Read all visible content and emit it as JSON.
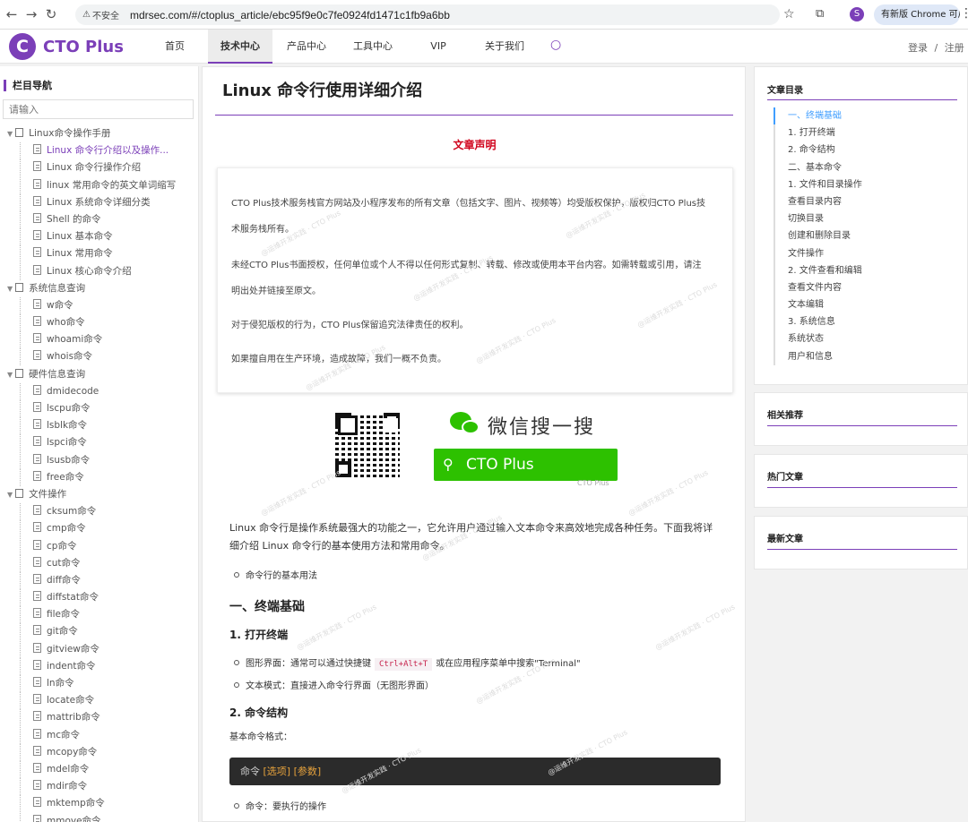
{
  "browser": {
    "url": "mdrsec.com/#/ctoplus_article/ebc95f9e0c7fe0924fd1471c1fb9a6bb",
    "security": "不安全",
    "profile_initial": "S",
    "update_label": "有新版 Chrome 可用"
  },
  "site": {
    "logo_letter": "C",
    "logo_text": "CTO Plus",
    "nav": [
      "首页",
      "技术中心",
      "产品中心",
      "工具中心",
      "VIP",
      "关于我们"
    ],
    "login": "登录",
    "separator": "/",
    "register": "注册"
  },
  "sidebar": {
    "title": "栏目导航",
    "search_placeholder": "请输入",
    "groups": [
      {
        "label": "Linux命令操作手册",
        "items": [
          "Linux 命令行介绍以及操作...",
          "Linux 命令行操作介绍",
          "linux 常用命令的英文单词缩写",
          "Linux 系统命令详细分类",
          "Shell 的命令",
          "Linux 基本命令",
          "Linux 常用命令",
          "Linux 核心命令介绍"
        ]
      },
      {
        "label": "系统信息查询",
        "items": [
          "w命令",
          "who命令",
          "whoami命令",
          "whois命令"
        ]
      },
      {
        "label": "硬件信息查询",
        "items": [
          "dmidecode",
          "lscpu命令",
          "lsblk命令",
          "lspci命令",
          "lsusb命令",
          "free命令"
        ]
      },
      {
        "label": "文件操作",
        "items": [
          "cksum命令",
          "cmp命令",
          "cp命令",
          "cut命令",
          "diff命令",
          "diffstat命令",
          "file命令",
          "git命令",
          "gitview命令",
          "indent命令",
          "ln命令",
          "locate命令",
          "mattrib命令",
          "mc命令",
          "mcopy命令",
          "mdel命令",
          "mdir命令",
          "mktemp命令",
          "mmove命令"
        ]
      }
    ]
  },
  "article": {
    "title": "Linux 命令行使用详细介绍",
    "declaration_title": "文章声明",
    "declaration": [
      "CTO Plus技术服务栈官方网站及小程序发布的所有文章（包括文字、图片、视频等）均受版权保护，版权归CTO Plus技",
      "术服务栈所有。",
      "未经CTO Plus书面授权，任何单位或个人不得以任何形式复制、转载、修改或使用本平台内容。如需转载或引用，请注",
      "明出处并链接至原文。",
      "对于侵犯版权的行为，CTO Plus保留追究法律责任的权利。",
      "如果擅自用在生产环境，造成故障，我们一概不负责。"
    ],
    "wechat_label": "微信搜一搜",
    "wechat_search": "CTO Plus",
    "wechat_small": "CTO Plus",
    "intro_1": "Linux 命令行是操作系统最强大的功能之一，它允许用户通过输入文本命令来高效地完成各种任务。下面我将详",
    "intro_2": "细介绍 Linux 命令行的基本使用方法和常用命令。",
    "bullet_basic": "命令行的基本用法",
    "h_terminal": "一、终端基础",
    "h_open": "1. 打开终端",
    "gui_pre": "图形界面：通常可以通过快捷键",
    "gui_key": "Ctrl+Alt+T",
    "gui_post": "或在应用程序菜单中搜索\"Terminal\"",
    "text_mode": "文本模式：直接进入命令行界面（无图形界面）",
    "h_struct": "2. 命令结构",
    "basic_format": "基本命令格式：",
    "code_cmd": "命令",
    "code_opt": "[选项]",
    "code_arg": "[参数]",
    "bullet_cmd": "命令：要执行的操作"
  },
  "toc": {
    "title": "文章目录",
    "items": [
      "一、终端基础",
      "1. 打开终端",
      "2. 命令结构",
      "二、基本命令",
      "1. 文件和目录操作",
      "查看目录内容",
      "切换目录",
      "创建和删除目录",
      "文件操作",
      "2. 文件查看和编辑",
      "查看文件内容",
      "文本编辑",
      "3. 系统信息",
      "系统状态",
      "用户和信息"
    ]
  },
  "widgets": {
    "related": "相关推荐",
    "hot": "热门文章",
    "latest": "最新文章"
  },
  "watermark": "@运维开发实践 · CTO Plus"
}
